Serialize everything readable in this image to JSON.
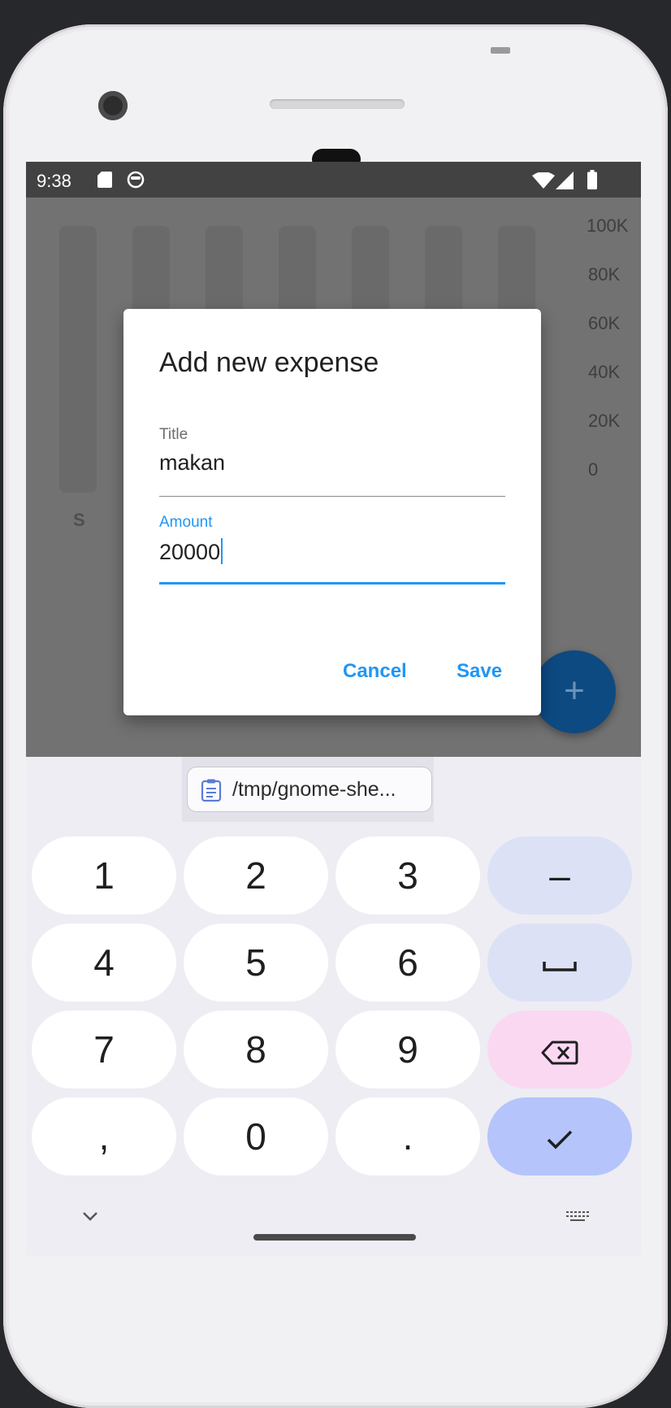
{
  "status_bar": {
    "time": "9:38",
    "icons": [
      "sd-card-icon",
      "circle-face-icon",
      "wifi-icon",
      "signal-icon",
      "battery-icon"
    ]
  },
  "chart_background": {
    "y_ticks": [
      "100K",
      "80K",
      "60K",
      "40K",
      "20K",
      "0"
    ],
    "day_labels": [
      "S"
    ],
    "bar_count": 7
  },
  "dialog": {
    "title": "Add new expense",
    "title_field": {
      "label": "Title",
      "value": "makan"
    },
    "amount_field": {
      "label": "Amount",
      "value": "20000"
    },
    "cancel_label": "Cancel",
    "save_label": "Save"
  },
  "fab": {
    "label": "+"
  },
  "keyboard": {
    "clipboard_suggestion": "/tmp/gnome-she...",
    "rows": [
      [
        "1",
        "2",
        "3",
        "–"
      ],
      [
        "4",
        "5",
        "6",
        "space"
      ],
      [
        "7",
        "8",
        "9",
        "backspace"
      ],
      [
        ",",
        "0",
        ".",
        "done"
      ]
    ]
  },
  "colors": {
    "accent": "#2196f3",
    "fab": "#0d4a82",
    "status_bar": "#424242",
    "dim_overlay": "#727272",
    "key_fn": "#dde1f5",
    "key_delete": "#fbd8f2",
    "key_done": "#b5c4fb"
  }
}
